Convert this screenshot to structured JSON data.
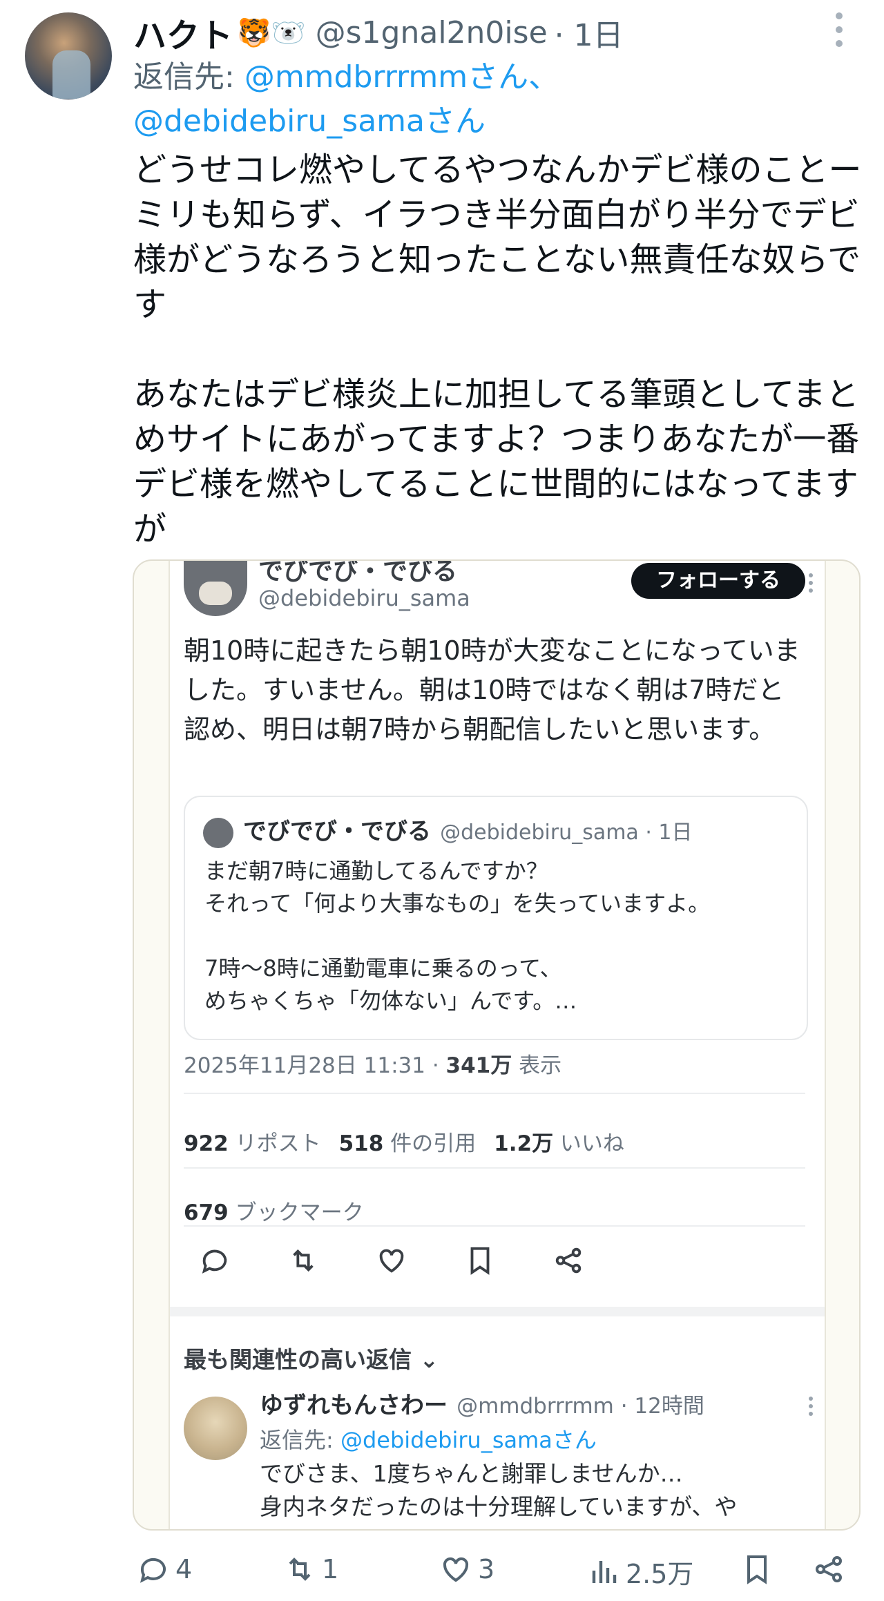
{
  "tweet": {
    "author_name": "ハクト",
    "author_emoji": "🐯🐻‍❄️",
    "handle": "@s1gnal2n0ise",
    "time": "· 1日",
    "reply_to_label": "返信先: ",
    "reply_to_1": "@mmdbrrrmmさん、",
    "reply_to_2": "@debidebiru_samaさん",
    "body": "どうせコレ燃やしてるやつなんかデビ様のことーミリも知らず、イラつき半分面白がり半分でデビ様がどうなろうと知ったことない無責任な奴らです\n\nあなたはデビ様炎上に加担してる筆頭としてまとめサイトにあがってますよ？つまりあなたが一番デビ様を燃やしてることに世間的にはなってますが"
  },
  "embedded": {
    "name": "でびでび・でびる",
    "handle": "@debidebiru_sama",
    "follow_label": "フォローする",
    "text": "朝10時に起きたら朝10時が大変なことになっていました。すいません。朝は10時ではなく朝は7時だと認め、明日は朝7時から朝配信したいと思います。",
    "quote": {
      "name": "でびでび・でびる",
      "handle": "@debidebiru_sama · 1日",
      "text": "まだ朝7時に通勤してるんですか？\nそれって「何より大事なもの」を失っていますよ。\n\n7時〜8時に通勤電車に乗るのって、\nめちゃくちゃ「勿体ない」んです。…"
    },
    "timestamp": "2025年11月28日 11:31 · ",
    "views_count": "341万",
    "views_label": " 表示",
    "reposts_count": "922",
    "reposts_label": " リポスト",
    "quotes_count": "518",
    "quotes_label": " 件の引用",
    "likes_count": "1.2万",
    "likes_label": " いいね",
    "bookmarks_count": "679",
    "bookmarks_label": " ブックマーク",
    "sort_label": "最も関連性の高い返信",
    "reply": {
      "name": "ゆずれもんさわー",
      "handle": "@mmdbrrrmm · 12時間",
      "reply_to_label": "返信先: ",
      "reply_to_mention": "@debidebiru_samaさん",
      "text": "でびさま、1度ちゃんと謝罪しませんか…\n身内ネタだったのは十分理解していますが、や"
    }
  },
  "actions": {
    "replies": "4",
    "reposts": "1",
    "likes": "3",
    "views": "2.5万"
  },
  "colors": {
    "link": "#1d9bf0",
    "muted": "#536471",
    "text": "#0f1419"
  }
}
